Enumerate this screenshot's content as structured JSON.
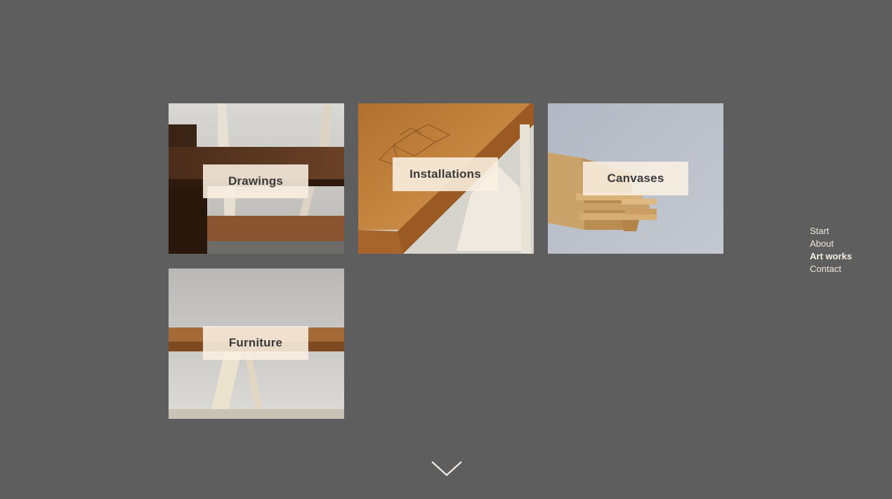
{
  "tiles": [
    {
      "id": "drawings",
      "label": "Drawings"
    },
    {
      "id": "installations",
      "label": "Installations"
    },
    {
      "id": "canvases",
      "label": "Canvases"
    },
    {
      "id": "furniture",
      "label": "Furniture"
    }
  ],
  "nav": {
    "items": [
      {
        "label": "Start",
        "active": false
      },
      {
        "label": "About",
        "active": false
      },
      {
        "label": "Art works",
        "active": true
      },
      {
        "label": "Contact",
        "active": false
      }
    ]
  },
  "scroll_icon": "chevron-down-icon",
  "colors": {
    "background": "#5e5e5e",
    "label_bg": "#faf0e1",
    "label_text": "#3a3a3a",
    "nav_text": "#efe6da"
  }
}
